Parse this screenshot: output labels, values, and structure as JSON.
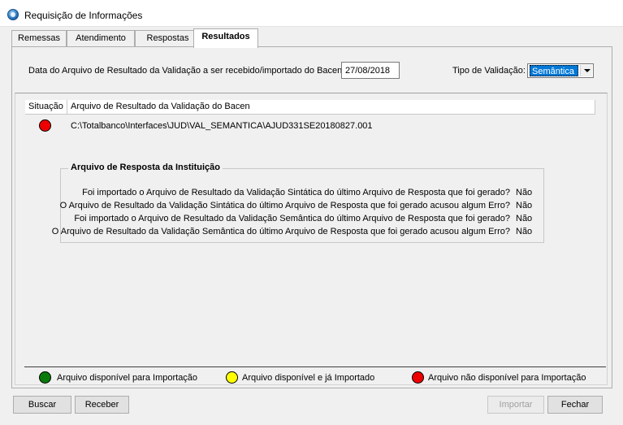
{
  "window": {
    "title": "Requisição de Informações",
    "icon": "app-globe-icon"
  },
  "tabs": [
    {
      "label": "Remessas",
      "active": false
    },
    {
      "label": "Atendimento",
      "active": false
    },
    {
      "label": "Respostas",
      "active": false
    },
    {
      "label": "Resultados",
      "active": true
    }
  ],
  "filters": {
    "date_label": "Data do Arquivo de Resultado da Validação a ser recebido/importado do Bacen:",
    "date_value": "27/08/2018",
    "tipo_label": "Tipo de Validação:",
    "tipo_value": "Semântica"
  },
  "list": {
    "columns": [
      "Situação",
      "Arquivo de Resultado da Validação do Bacen"
    ],
    "rows": [
      {
        "status": "red",
        "path": "C:\\Totalbanco\\Interfaces\\JUD\\VAL_SEMANTICA\\AJUD331SE20180827.001"
      }
    ]
  },
  "resposta": {
    "title": "Arquivo de Resposta da Instituição",
    "items": [
      {
        "question": "Foi importado o Arquivo de Resultado da Validação Sintática do último Arquivo de Resposta que foi gerado?",
        "answer": "Não"
      },
      {
        "question": "O Arquivo de Resultado da Validação Sintática do último Arquivo de Resposta que foi gerado acusou algum Erro?",
        "answer": "Não"
      },
      {
        "question": "Foi importado o Arquivo de Resultado da Validação Semântica do último Arquivo de Resposta que foi gerado?",
        "answer": "Não"
      },
      {
        "question": "O Arquivo de Resultado da Validação Semântica do último Arquivo de Resposta que foi gerado acusou algum Erro?",
        "answer": "Não"
      }
    ]
  },
  "legend": [
    {
      "color": "#0a7a0a",
      "label": "Arquivo disponível para Importação"
    },
    {
      "color": "#ffff00",
      "label": "Arquivo disponível e já Importado"
    },
    {
      "color": "#ee0000",
      "label": "Arquivo não disponível para Importação"
    }
  ],
  "buttons": {
    "buscar": "Buscar",
    "receber": "Receber",
    "importar": "Importar",
    "fechar": "Fechar"
  },
  "colors": {
    "status_red": "#ee0000",
    "selection_blue": "#0078d7"
  }
}
